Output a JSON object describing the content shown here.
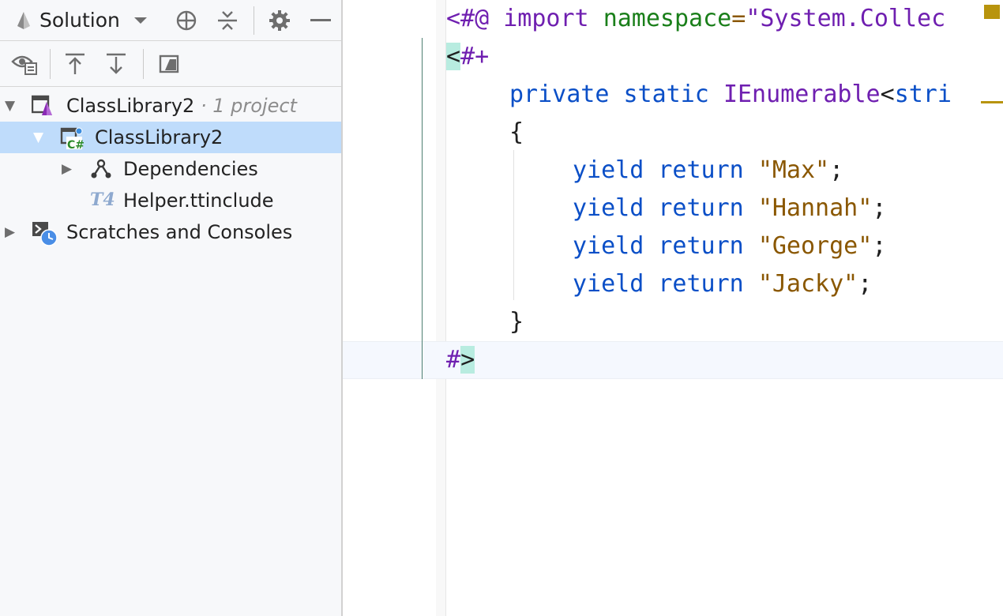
{
  "solution_panel": {
    "view_selector_label": "Solution",
    "tree": [
      {
        "label": "ClassLibrary2",
        "hint": "· 1 project"
      },
      {
        "label": "ClassLibrary2"
      },
      {
        "label": "Dependencies"
      },
      {
        "label": "Helper.ttinclude",
        "icon_text": "T4"
      },
      {
        "label": "Scratches and Consoles"
      }
    ]
  },
  "editor": {
    "lines": [
      {
        "directive_open": "<#@",
        "directive_name": "import",
        "attr_name": "namespace",
        "eq": "=",
        "value": "\"System.Collec"
      },
      {
        "block_open_prefix": "<",
        "block_open_rest": "#+"
      },
      {
        "kw1": "private",
        "kw2": "static",
        "type": "IEnumerable",
        "lt": "<",
        "type2": "stri"
      },
      {
        "text": "{"
      },
      {
        "kw1": "yield",
        "kw2": "return",
        "str": "\"Max\"",
        "semi": ";"
      },
      {
        "kw1": "yield",
        "kw2": "return",
        "str": "\"Hannah\"",
        "semi": ";"
      },
      {
        "kw1": "yield",
        "kw2": "return",
        "str": "\"George\"",
        "semi": ";"
      },
      {
        "kw1": "yield",
        "kw2": "return",
        "str": "\"Jacky\"",
        "semi": ";"
      },
      {
        "text": "}"
      },
      {
        "block_close_hash": "#",
        "block_close_gt": ">"
      }
    ]
  },
  "colors": {
    "selection": "#bfdcfb",
    "keyword": "#0033b3",
    "string": "#8a5700",
    "directive": "#6f1fb0",
    "t4_tag_bg": "#b8ece0",
    "warning": "#b8940d"
  },
  "icons": [
    "solution-view-icon",
    "chevron-down-icon",
    "locate-icon",
    "collapse-all-icon",
    "settings-icon",
    "minimize-icon",
    "show-hidden-icon",
    "expand-up-icon",
    "expand-down-icon",
    "preview-icon",
    "solution-icon",
    "csharp-project-icon",
    "dependencies-icon",
    "t4-file-icon",
    "scratches-icon"
  ]
}
